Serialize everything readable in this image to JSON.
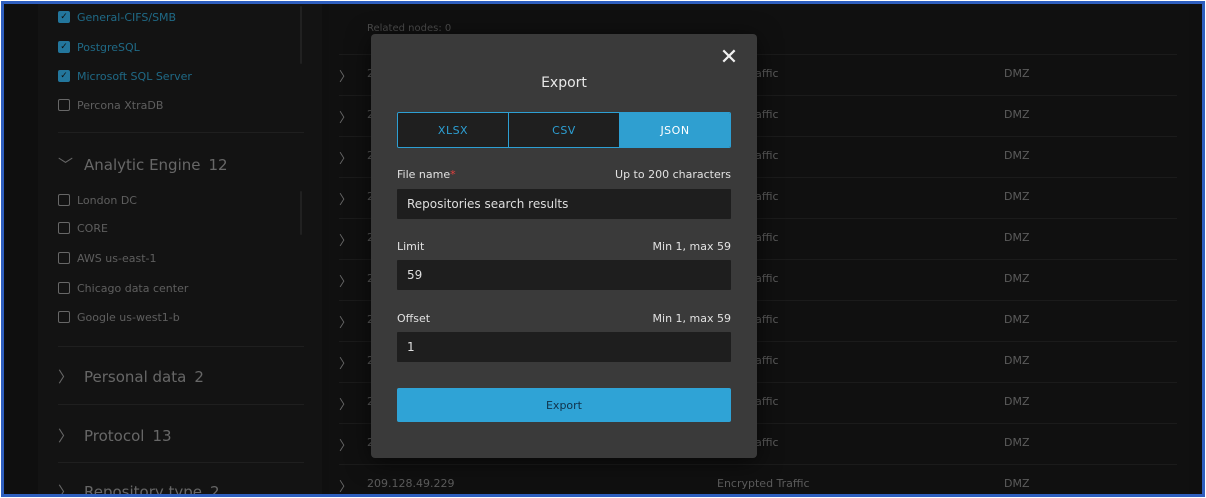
{
  "left_panel": {
    "checked_items": [
      "General-CIFS/SMB",
      "PostgreSQL",
      "Microsoft SQL Server"
    ],
    "unchecked_items": [
      "Percona XtraDB"
    ],
    "analytic_engine": {
      "title": "Analytic Engine",
      "count": "12",
      "items": [
        "London DC",
        "CORE",
        "AWS us-east-1",
        "Chicago data center",
        "Google us-west1-b"
      ]
    },
    "sections": [
      {
        "title": "Personal data",
        "count": "2"
      },
      {
        "title": "Protocol",
        "count": "13"
      },
      {
        "title": "Repository type",
        "count": "2"
      }
    ]
  },
  "table": {
    "related_nodes": "Related nodes: 0",
    "rows": [
      {
        "ip": "2",
        "service": "pted Traffic",
        "zone": "DMZ"
      },
      {
        "ip": "2",
        "service": "pted Traffic",
        "zone": "DMZ"
      },
      {
        "ip": "2",
        "service": "pted Traffic",
        "zone": "DMZ"
      },
      {
        "ip": "2",
        "service": "pted Traffic",
        "zone": "DMZ"
      },
      {
        "ip": "2",
        "service": "pted Traffic",
        "zone": "DMZ"
      },
      {
        "ip": "2",
        "service": "pted Traffic",
        "zone": "DMZ"
      },
      {
        "ip": "2",
        "service": "pted Traffic",
        "zone": "DMZ"
      },
      {
        "ip": "2",
        "service": "pted Traffic",
        "zone": "DMZ"
      },
      {
        "ip": "2",
        "service": "pted Traffic",
        "zone": "DMZ"
      },
      {
        "ip": "209.128.49.229",
        "service": "Encrypted Traffic",
        "zone": "DMZ"
      }
    ]
  },
  "modal": {
    "title": "Export",
    "close_icon": "close-icon",
    "formats": [
      "XLSX",
      "CSV",
      "JSON"
    ],
    "selected_format": "JSON",
    "file_name": {
      "label": "File name",
      "required_mark": "*",
      "hint": "Up to 200 characters",
      "value": "Repositories search results"
    },
    "limit": {
      "label": "Limit",
      "hint": "Min 1, max 59",
      "value": "59"
    },
    "offset": {
      "label": "Offset",
      "hint": "Min 1, max 59",
      "value": "1"
    },
    "export_label": "Export"
  },
  "colors": {
    "accent": "#2f9fd0",
    "required": "#e2403e",
    "modal_bg": "#3a3a3a",
    "frame_border": "#2f5fbf"
  }
}
